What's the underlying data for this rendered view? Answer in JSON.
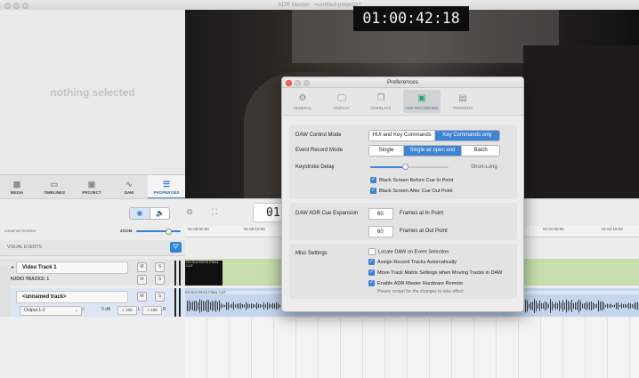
{
  "window": {
    "title": "ADR Master - <untitled project>*"
  },
  "left_panel": {
    "empty_message": "nothing selected"
  },
  "left_tabs": [
    {
      "label": "MEDIA",
      "icon": "film-icon"
    },
    {
      "label": "TIMELINES",
      "icon": "timeline-icon"
    },
    {
      "label": "PROJECT",
      "icon": "project-icon"
    },
    {
      "label": "DAW",
      "icon": "waveform-icon"
    },
    {
      "label": "PROPERTIES",
      "icon": "properties-icon",
      "active": true
    }
  ],
  "video": {
    "timecode": "01:00:42:18"
  },
  "toolbar": {
    "timecode_partial": "01"
  },
  "timeline": {
    "name": "unnamed timeline",
    "zoom_label": "ZOOM",
    "ruler": [
      "01:00:00:00",
      "01:00:10:00",
      "01:01:00:00",
      "01:01:10:00"
    ],
    "visual_events_label": "VISUAL EVENTS"
  },
  "video_track": {
    "name": "Video Track 1",
    "clip_label": "RH DUCHESS FINAL CUT",
    "mute": "M",
    "solo": "S"
  },
  "audio_tracks": {
    "label": "AUDIO TRACKS: 1",
    "track_name": "<unnamed track>",
    "output": "Output 1-2",
    "gain": "0 dB",
    "pan_left": "< 100",
    "pan_l": "L",
    "pan_right": "> 100",
    "pan_r": "R",
    "clip_label": "RH DUCHESS FINAL CUT",
    "mute": "M",
    "solo": "S"
  },
  "preferences": {
    "title": "Preferences",
    "tabs": [
      {
        "label": "GENERAL",
        "icon": "gear-icon"
      },
      {
        "label": "DISPLAY",
        "icon": "display-icon"
      },
      {
        "label": "OVERLAYS",
        "icon": "overlays-icon"
      },
      {
        "label": "ADR RECORDING",
        "icon": "adr-recording-icon",
        "active": true
      },
      {
        "label": "TRIGGERS",
        "icon": "triggers-icon"
      }
    ],
    "daw_control_mode": {
      "label": "DAW Control Mode",
      "options": [
        "HUI and Key Commands",
        "Key Commands only"
      ],
      "selected": "Key Commands only"
    },
    "event_record_mode": {
      "label": "Event Record Mode",
      "options": [
        "Single",
        "Single w/ open end",
        "Batch"
      ],
      "selected": "Single w/ open end"
    },
    "keystroke_delay": {
      "label": "Keystroke Delay",
      "value": 0.45,
      "max_label": "Short-Long"
    },
    "black_before": {
      "label": "Black Screen Before Cue In Point",
      "checked": true
    },
    "black_after": {
      "label": "Black Screen After Cue Out Point",
      "checked": true
    },
    "cue_expansion": {
      "label": "DAW ADR Cue Expansion",
      "in_value": "60",
      "in_label": "Frames at In Point",
      "out_value": "60",
      "out_label": "Frames at Out Point"
    },
    "misc": {
      "label": "Misc Settings",
      "options": [
        {
          "label": "Locate DAW on Event Selection",
          "checked": false
        },
        {
          "label": "Assign Record Tracks Automatically",
          "checked": true
        },
        {
          "label": "Move Track Matrix Settings when Moving Tracks in DAW",
          "checked": true
        },
        {
          "label": "Enable ADR Master Hardware Remote",
          "checked": true
        }
      ],
      "hint": "Please restart for the changes to take effect."
    }
  },
  "colors": {
    "accent": "#3f83d4",
    "video_lane": "#c8deae",
    "audio_lane": "#c4d6ee"
  }
}
